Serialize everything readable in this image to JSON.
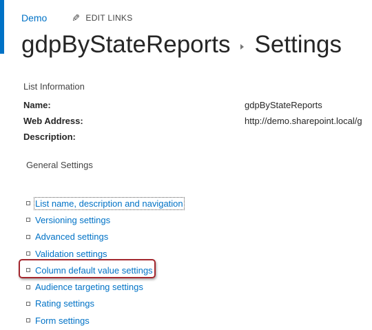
{
  "header": {
    "site_link": "Demo",
    "edit_links_label": "EDIT LINKS",
    "title_list": "gdpByStateReports",
    "title_page": "Settings"
  },
  "list_information": {
    "heading": "List Information",
    "name_label": "Name:",
    "name_value": "gdpByStateReports",
    "web_address_label": "Web Address:",
    "web_address_value": "http://demo.sharepoint.local/g",
    "description_label": "Description:"
  },
  "general_settings": {
    "heading": "General Settings",
    "items": [
      {
        "label": "List name, description and navigation"
      },
      {
        "label": "Versioning settings"
      },
      {
        "label": "Advanced settings"
      },
      {
        "label": "Validation settings"
      },
      {
        "label": "Column default value settings"
      },
      {
        "label": "Audience targeting settings"
      },
      {
        "label": "Rating settings"
      },
      {
        "label": "Form settings"
      }
    ]
  },
  "colors": {
    "accent": "#0072c6",
    "highlight": "#a3262d"
  }
}
